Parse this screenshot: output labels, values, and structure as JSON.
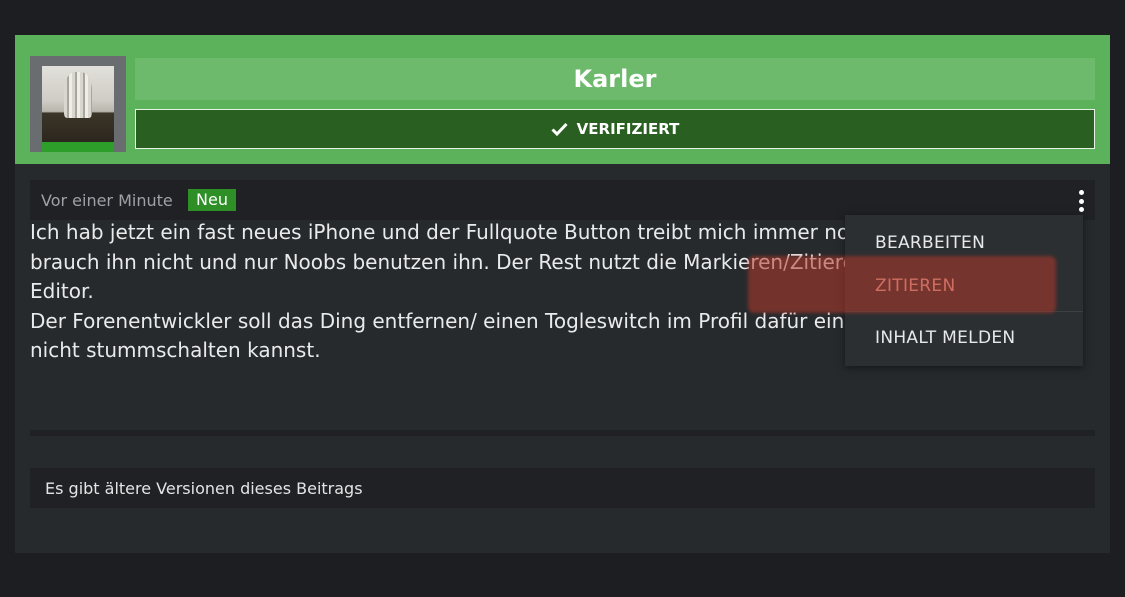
{
  "author": {
    "name": "Karler",
    "verified_label": "VERIFIZIERT"
  },
  "meta": {
    "time": "Vor einer Minute",
    "badge": "Neu"
  },
  "post": {
    "lines": [
      "Ich hab jetzt ein fast neues iPhone und der Fullquote Button treibt mich immer noch",
      "brauch ihn nicht und nur Noobs benutzen ihn. Der Rest nutzt die Markieren/Zitieren",
      "Editor.",
      "Der Forenentwickler soll das Ding entfernen/ einen Togleswitch im Profil dafür einrichten",
      "nicht stummschalten kannst."
    ]
  },
  "versions_note": "Es gibt ältere Versionen dieses Beitrags",
  "dropdown": {
    "items": [
      "BEARBEITEN",
      "ZITIEREN",
      "INHALT MELDEN"
    ]
  },
  "colors": {
    "header_green": "#5cb15b",
    "verified_bg": "#2a5f22",
    "badge_green": "#2e8f26",
    "highlight": "#b2382a"
  }
}
